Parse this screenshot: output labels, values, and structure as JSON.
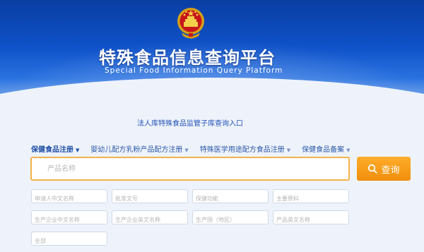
{
  "header": {
    "title": "特殊食品信息查询平台",
    "subtitle": "Special Food Information Query Platform",
    "emblem_icon": "national-emblem-icon"
  },
  "entry_link": "法人库特殊食品监管子库查询入口",
  "tabs": [
    {
      "label": "保健食品注册",
      "active": true
    },
    {
      "label": "婴幼儿配方乳粉产品配方注册",
      "active": false
    },
    {
      "label": "特殊医学用途配方食品注册",
      "active": false
    },
    {
      "label": "保健食品备案",
      "active": false
    }
  ],
  "search": {
    "placeholder": "产品名称",
    "button_label": "查询",
    "button_icon": "search-icon"
  },
  "filters": {
    "applicant_cn": "申请人中文名称",
    "approval_no": "批准文号",
    "health_function": "保健功能",
    "main_ingredient": "主要原料",
    "manufacturer_cn": "生产企业中文名称",
    "manufacturer_en": "生产企业英文名称",
    "country_region": "生产国（地区）",
    "product_en_name": "产品英文名称",
    "all": "全部"
  },
  "colors": {
    "header_blue": "#0f52c9",
    "accent_orange": "#f5a01e",
    "link_blue": "#2150b8"
  }
}
